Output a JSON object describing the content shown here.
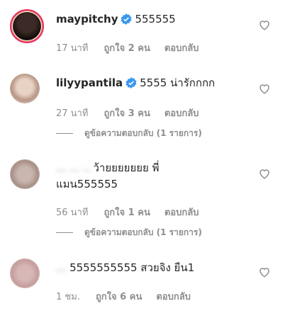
{
  "comments": [
    {
      "username": "maypitchy",
      "verified": true,
      "text": "555555",
      "time": "17 นาที",
      "likes": "ถูกใจ 2 คน",
      "reply": "ตอบกลับ"
    },
    {
      "username": "lilyypantila",
      "verified": true,
      "text": "5555 น่ารักกกก",
      "time": "27 นาที",
      "likes": "ถูกใจ 3 คน",
      "reply": "ตอบกลับ",
      "view_replies": "ดูข้อความตอบกลับ (1 รายการ)"
    },
    {
      "username": "... ... ..",
      "verified": false,
      "text_line1": "ว้ายยยยยยย พี่",
      "text_line2": "แมน555555",
      "time": "56 นาที",
      "likes": "ถูกใจ 1 คน",
      "reply": "ตอบกลับ",
      "view_replies": "ดูข้อความตอบกลับ (1 รายการ)"
    },
    {
      "username": "...",
      "verified": false,
      "text": "5555555555 สวยจิง ยืน1",
      "time": "1 ชม.",
      "likes": "ถูกใจ 6 คน",
      "reply": "ตอบกลับ"
    }
  ],
  "icons": {
    "verified_color": "#3897f0",
    "heart": "heart-outline-icon"
  }
}
